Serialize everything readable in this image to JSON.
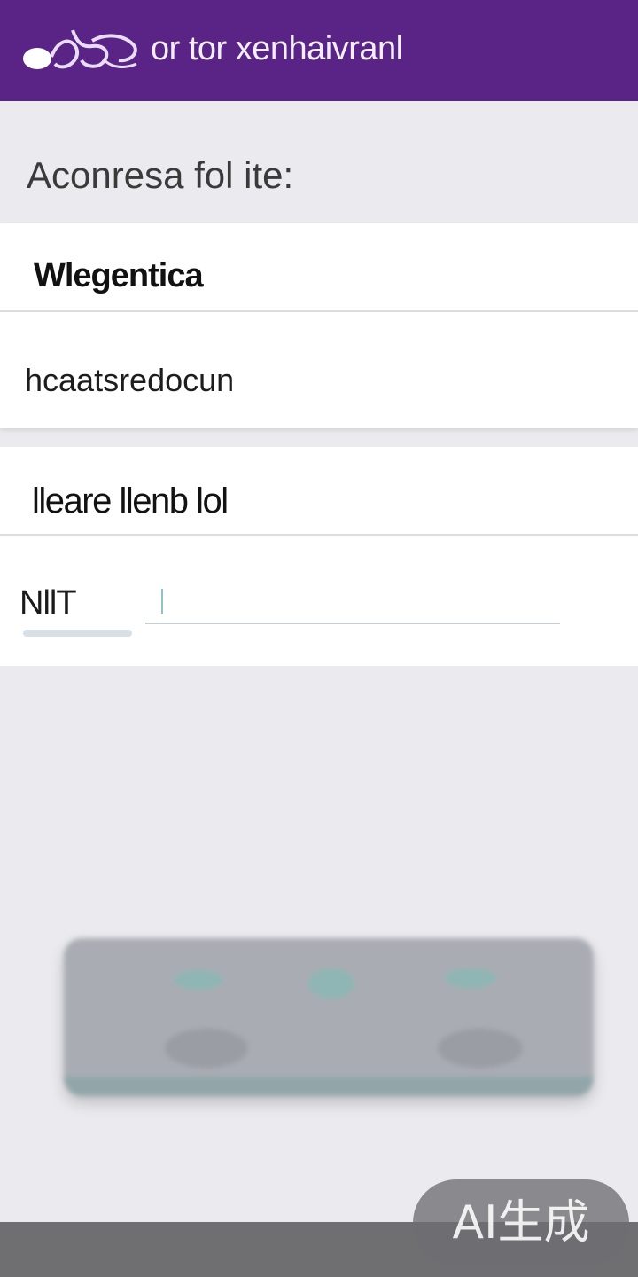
{
  "header": {
    "title": "or tor xenhaivranl",
    "logo_icon": "app-logo-icon",
    "background": "#5a2386"
  },
  "section": {
    "label": "Aconresa fol ite:"
  },
  "card1": {
    "title": "Wlegentica",
    "value": "hcaatsredocun"
  },
  "card2": {
    "title": "lleare llenb lol",
    "field_label": "NllT",
    "input_value": ""
  },
  "watermark": {
    "text": "AI生成"
  }
}
